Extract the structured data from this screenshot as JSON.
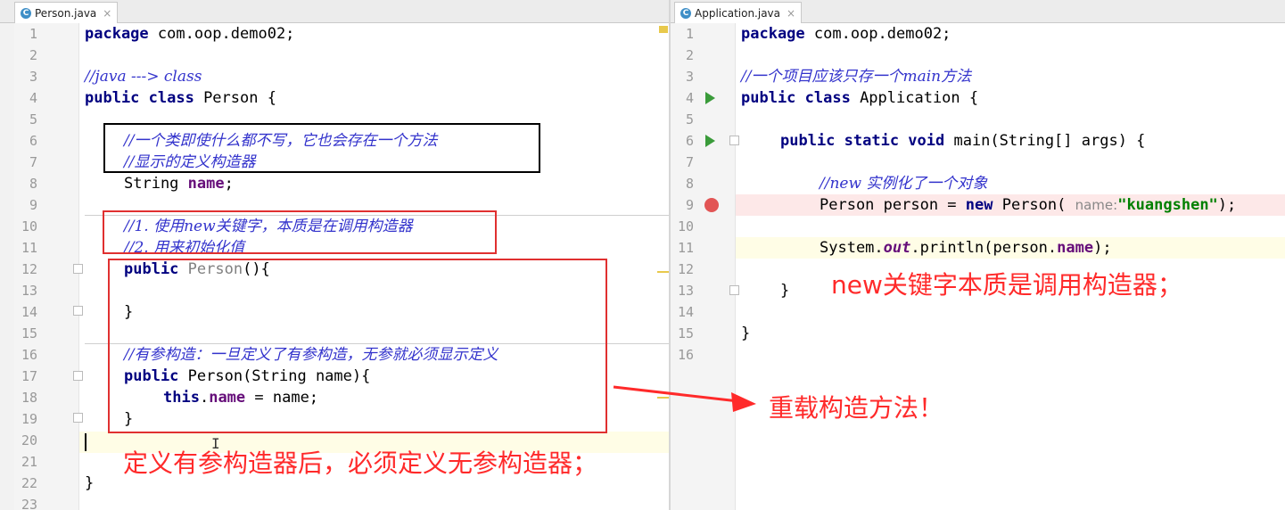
{
  "left_editor": {
    "tab_label": "Person.java",
    "tab_icon": "C",
    "line_numbers": [
      "1",
      "2",
      "3",
      "4",
      "5",
      "6",
      "7",
      "8",
      "9",
      "10",
      "11",
      "12",
      "13",
      "14",
      "15",
      "16",
      "17",
      "18",
      "19",
      "20",
      "21",
      "22",
      "23"
    ],
    "code": {
      "l1_kw": "package",
      "l1_rest": " com.oop.demo02;",
      "l3": "//java ---> class",
      "l4_kw": "public class",
      "l4_rest": " Person {",
      "l6": "//一个类即使什么都不写，它也会存在一个方法",
      "l7": "//显示的定义构造器",
      "l8_type": "String ",
      "l8_field": "name",
      "l8_end": ";",
      "l10": "//1. 使用new关键字，本质是在调用构造器",
      "l11": "//2. 用来初始化值",
      "l12_kw": "public",
      "l12_name": " Person",
      "l12_rest": "(){",
      "l14": "}",
      "l16": "//有参构造：一旦定义了有参构造，无参就必须显示定义",
      "l17_kw": "public",
      "l17_rest": " Person(String name){",
      "l18_kw": "this",
      "l18_dot": ".",
      "l18_field": "name",
      "l18_rest": " = name;",
      "l19": "}",
      "l22": "}"
    }
  },
  "right_editor": {
    "tab_label": "Application.java",
    "tab_icon": "C",
    "line_numbers": [
      "1",
      "2",
      "3",
      "4",
      "5",
      "6",
      "7",
      "8",
      "9",
      "10",
      "11",
      "12",
      "13",
      "14",
      "15",
      "16"
    ],
    "code": {
      "l1_kw": "package",
      "l1_rest": " com.oop.demo02;",
      "l3": "//一个项目应该只存一个main方法",
      "l4_kw": "public class",
      "l4_rest": " Application {",
      "l6_kw": "public static void",
      "l6_rest": " main(String[] args) {",
      "l8": "//new 实例化了一个对象",
      "l9_a": "Person person = ",
      "l9_kw": "new",
      "l9_b": " Person( ",
      "l9_hint": "name:",
      "l9_str": "\"kuangshen\"",
      "l9_end": ");",
      "l11_a": "System.",
      "l11_out": "out",
      "l11_b": ".println(person.",
      "l11_field": "name",
      "l11_end": ");",
      "l13": "}",
      "l15": "}"
    }
  },
  "annotations": {
    "new_keyword_note": "new关键字本质是调用构造器；",
    "overload_note": "重载构造方法！",
    "param_constructor_note": "定义有参构造器后，必须定义无参构造器；"
  },
  "colors": {
    "annotation_red": "#ff2a2a",
    "box_black": "#000000",
    "keyword": "#000080",
    "comment": "#3333cc",
    "field": "#660e7a",
    "string": "#008000",
    "breakpoint": "#e25555",
    "run_gutter": "#3a9b3a"
  }
}
